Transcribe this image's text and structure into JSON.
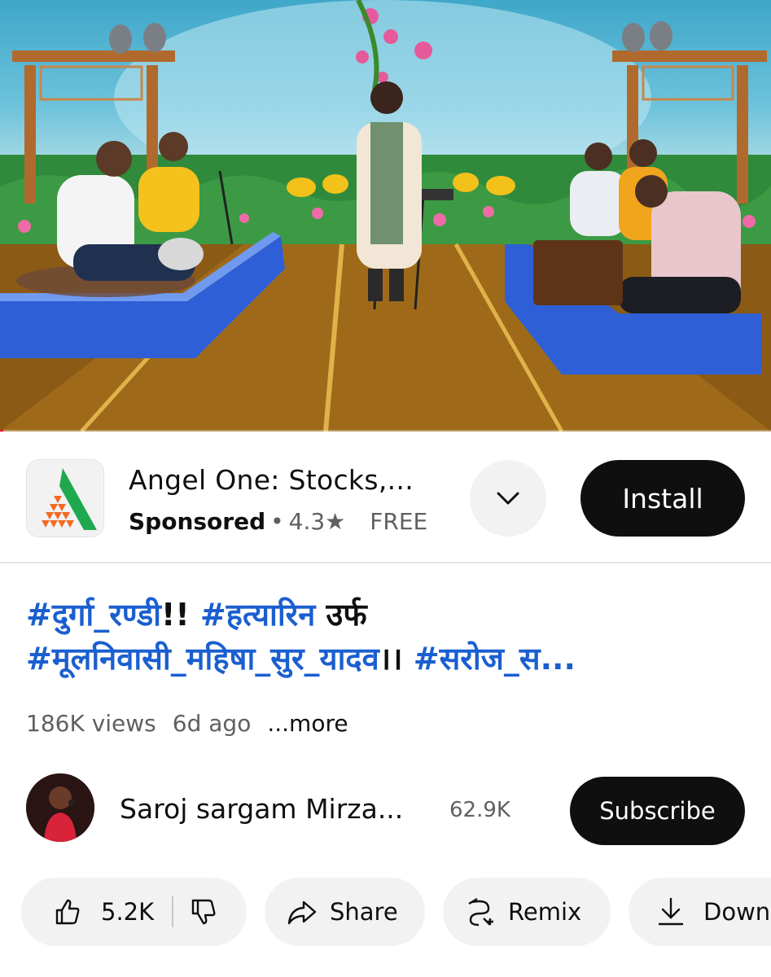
{
  "video": {
    "progress_fraction": 0.004
  },
  "ad": {
    "title": "Angel One: Stocks,...",
    "sponsored": "Sponsored",
    "separator": "•",
    "rating": "4.3",
    "rating_icon": "★",
    "price": "FREE",
    "expand_icon": "chevron-down-icon",
    "install_label": "Install",
    "logo_colors": {
      "triangles": "#f26a21",
      "check": "#1fa84f"
    }
  },
  "video_info": {
    "title_line1": [
      {
        "text": "#दुर्गा_रण्डी",
        "kind": "tag"
      },
      {
        "text": "!! ",
        "kind": "plain"
      },
      {
        "text": "#हत्यारिन",
        "kind": "tag"
      },
      {
        "text": " उर्फ",
        "kind": "plain"
      }
    ],
    "title_line2": [
      {
        "text": "#मूलनिवासी_महिषा_सुर_यादव",
        "kind": "tag"
      },
      {
        "text": "।। ",
        "kind": "plain"
      },
      {
        "text": "#सरोज_स...",
        "kind": "tag"
      }
    ],
    "views": "186K views",
    "age": "6d ago",
    "more": "...more"
  },
  "channel": {
    "name": "Saroj sargam Mirza...",
    "subscribers": "62.9K",
    "subscribe_label": "Subscribe"
  },
  "actions": {
    "like_count": "5.2K",
    "share_label": "Share",
    "remix_label": "Remix",
    "download_label": "Down"
  },
  "colors": {
    "tag_blue": "#1a5fd0",
    "progress_red": "#ff0033",
    "button_dark": "#0f0f0f"
  }
}
